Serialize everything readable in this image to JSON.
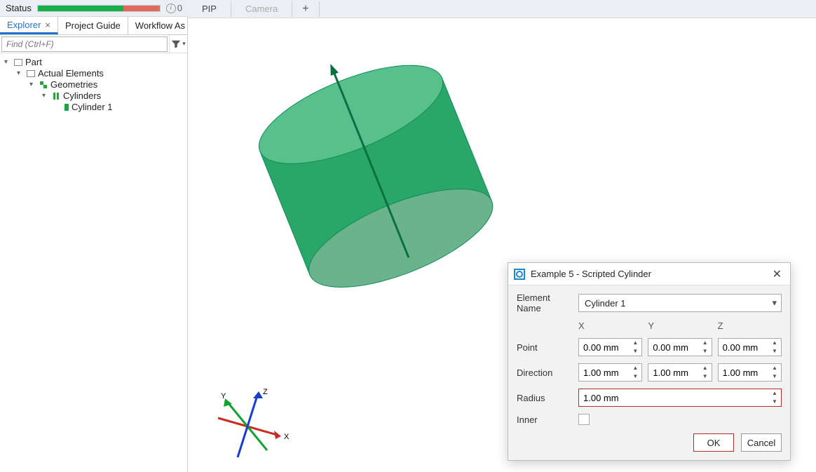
{
  "status": {
    "label": "Status",
    "info_count": "0"
  },
  "left_tabs": {
    "explorer": "Explorer",
    "project_guide": "Project Guide",
    "workflow": "Workflow As"
  },
  "find": {
    "placeholder": "Find (Ctrl+F)"
  },
  "tree": {
    "part": "Part",
    "actual": "Actual Elements",
    "geom": "Geometries",
    "cyls": "Cylinders",
    "cyl1": "Cylinder 1"
  },
  "view_tabs": {
    "pip": "PIP",
    "camera": "Camera",
    "plus": "+"
  },
  "dialog": {
    "title": "Example 5 - Scripted Cylinder",
    "elem_label": "Element Name",
    "elem_value": "Cylinder 1",
    "col_x": "X",
    "col_y": "Y",
    "col_z": "Z",
    "point_label": "Point",
    "point_x": "0.00 mm",
    "point_y": "0.00 mm",
    "point_z": "0.00 mm",
    "dir_label": "Direction",
    "dir_x": "1.00 mm",
    "dir_y": "1.00 mm",
    "dir_z": "1.00 mm",
    "radius_label": "Radius",
    "radius_value": "1.00 mm",
    "inner_label": "Inner",
    "ok": "OK",
    "cancel": "Cancel"
  },
  "axes": {
    "x": "X",
    "y": "Y",
    "z": "Z"
  }
}
